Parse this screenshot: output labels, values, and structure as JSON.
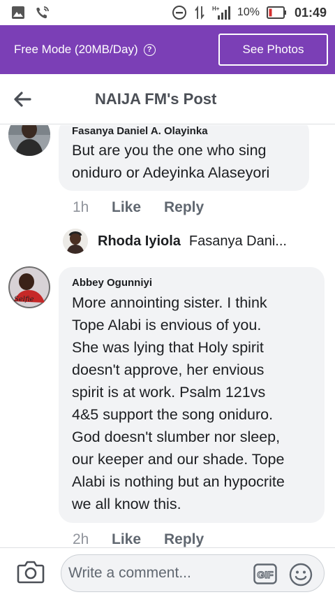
{
  "status_bar": {
    "battery": "10%",
    "time": "01:49"
  },
  "banner": {
    "free_mode": "Free Mode (20MB/Day)",
    "see_photos": "See Photos"
  },
  "header": {
    "title": "NAIJA FM's Post"
  },
  "comments": [
    {
      "author": "Fasanya Daniel A. Olayinka",
      "lines": [
        "But are you the one who sing",
        "oniduro or Adeyinka Alaseyori"
      ],
      "time": "1h",
      "like": "Like",
      "reply": "Reply"
    },
    {
      "author": "Abbey Ogunniyi",
      "lines": [
        "More annointing sister. I think",
        "Tope Alabi is envious of you.",
        "She was lying that Holy spirit",
        "doesn't approve, her envious",
        "spirit is at work. Psalm 121vs",
        "4&5 support the song oniduro.",
        "God doesn't slumber nor sleep,",
        "our keeper and our shade. Tope",
        "Alabi is nothing but an hypocrite",
        "we all know this."
      ],
      "time": "2h",
      "like": "Like",
      "reply": "Reply"
    }
  ],
  "reply_preview": {
    "name": "Rhoda Iyiola",
    "text": "Fasanya Dani..."
  },
  "composer": {
    "placeholder": "Write a comment..."
  },
  "colors": {
    "banner": "#7b3fb6",
    "bubble": "#f2f3f5"
  }
}
